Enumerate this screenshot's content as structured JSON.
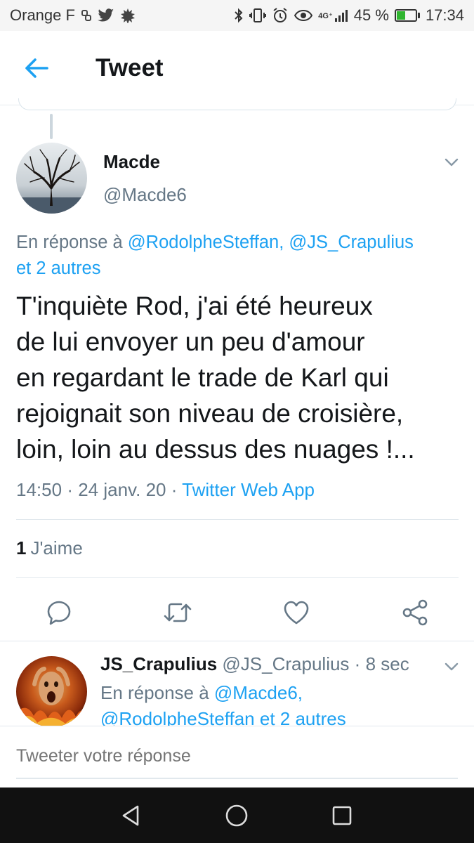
{
  "status_bar": {
    "carrier": "Orange F",
    "battery_percent": "45 %",
    "time": "17:34",
    "network": "4G⁺",
    "icons": [
      "link-icon",
      "twitter-bird-icon",
      "splat-icon",
      "bluetooth-icon",
      "vibrate-icon",
      "alarm-icon",
      "eye-icon",
      "signal-icon",
      "battery-icon"
    ]
  },
  "header": {
    "title": "Tweet",
    "back_icon": "arrow-left-icon"
  },
  "main_tweet": {
    "author_name": "Macde",
    "author_handle": "@Macde6",
    "reply_prefix": "En réponse à",
    "reply_mentions": "@RodolpheSteffan, @JS_Crapulius",
    "reply_suffix": "et 2 autres",
    "text_lines": [
      "T'inquiète Rod, j'ai été heureux",
      "de lui envoyer un peu d'amour",
      "en regardant le trade de Karl qui",
      "rejoignait son niveau de croisière,",
      "loin, loin au dessus des nuages !..."
    ],
    "time": "14:50",
    "date": "24 janv. 20",
    "separator": "·",
    "source": "Twitter Web App",
    "likes_count": "1",
    "likes_label": "J'aime"
  },
  "actions": [
    "reply-icon",
    "retweet-icon",
    "like-icon",
    "share-icon"
  ],
  "reply_tweet": {
    "author_name": "JS_Crapulius",
    "author_handle": "@JS_Crapulius",
    "separator": "·",
    "time_ago": "8 sec",
    "reply_prefix": "En réponse à",
    "mention_1": "@Macde6,",
    "mention_2": "@RodolpheSteffan et 2 autres"
  },
  "compose": {
    "placeholder": "Tweeter votre réponse"
  },
  "colors": {
    "accent": "#1da1f2",
    "text": "#14171a",
    "muted": "#657786"
  }
}
